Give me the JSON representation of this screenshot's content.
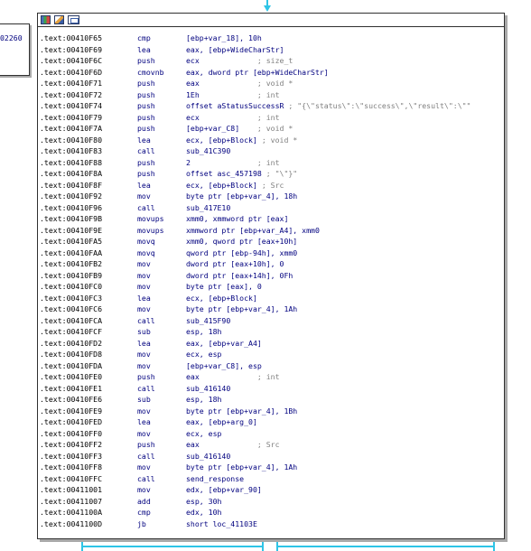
{
  "left_node": {
    "label": "02260"
  },
  "toolbar": {
    "icons": [
      "graph-overview-icon",
      "pencil-edit-icon",
      "zoom-icon"
    ]
  },
  "lines": [
    {
      "addr": ".text:00410F65",
      "mnem": "cmp",
      "ops": "[ebp+var_18], 10h",
      "cmt": ""
    },
    {
      "addr": ".text:00410F69",
      "mnem": "lea",
      "ops": "eax, [ebp+WideCharStr]",
      "cmt": ""
    },
    {
      "addr": ".text:00410F6C",
      "mnem": "push",
      "ops": "ecx             ",
      "cmt": "; size_t"
    },
    {
      "addr": ".text:00410F6D",
      "mnem": "cmovnb",
      "ops": "eax, dword ptr [ebp+WideCharStr]",
      "cmt": ""
    },
    {
      "addr": ".text:00410F71",
      "mnem": "push",
      "ops": "eax             ",
      "cmt": "; void *"
    },
    {
      "addr": ".text:00410F72",
      "mnem": "push",
      "ops": "1Eh             ",
      "cmt": "; int"
    },
    {
      "addr": ".text:00410F74",
      "mnem": "push",
      "ops": "offset aStatusSuccessR ",
      "cmt": "; \"{\\\"status\\\":\\\"success\\\",\\\"result\\\":\\\"\""
    },
    {
      "addr": ".text:00410F79",
      "mnem": "push",
      "ops": "ecx             ",
      "cmt": "; int"
    },
    {
      "addr": ".text:00410F7A",
      "mnem": "push",
      "ops": "[ebp+var_C8]    ",
      "cmt": "; void *"
    },
    {
      "addr": ".text:00410F80",
      "mnem": "lea",
      "ops": "ecx, [ebp+Block] ",
      "cmt": "; void *"
    },
    {
      "addr": ".text:00410F83",
      "mnem": "call",
      "ops": "sub_41C390",
      "cmt": ""
    },
    {
      "addr": ".text:00410F88",
      "mnem": "push",
      "ops": "2               ",
      "cmt": "; int"
    },
    {
      "addr": ".text:00410F8A",
      "mnem": "push",
      "ops": "offset asc_457198 ",
      "cmt": "; \"\\\"}\""
    },
    {
      "addr": ".text:00410F8F",
      "mnem": "lea",
      "ops": "ecx, [ebp+Block] ",
      "cmt": "; Src"
    },
    {
      "addr": ".text:00410F92",
      "mnem": "mov",
      "ops": "byte ptr [ebp+var_4], 18h",
      "cmt": ""
    },
    {
      "addr": ".text:00410F96",
      "mnem": "call",
      "ops": "sub_417E10",
      "cmt": ""
    },
    {
      "addr": ".text:00410F9B",
      "mnem": "movups",
      "ops": "xmm0, xmmword ptr [eax]",
      "cmt": ""
    },
    {
      "addr": ".text:00410F9E",
      "mnem": "movups",
      "ops": "xmmword ptr [ebp+var_A4], xmm0",
      "cmt": ""
    },
    {
      "addr": ".text:00410FA5",
      "mnem": "movq",
      "ops": "xmm0, qword ptr [eax+10h]",
      "cmt": ""
    },
    {
      "addr": ".text:00410FAA",
      "mnem": "movq",
      "ops": "qword ptr [ebp-94h], xmm0",
      "cmt": ""
    },
    {
      "addr": ".text:00410FB2",
      "mnem": "mov",
      "ops": "dword ptr [eax+10h], 0",
      "cmt": ""
    },
    {
      "addr": ".text:00410FB9",
      "mnem": "mov",
      "ops": "dword ptr [eax+14h], 0Fh",
      "cmt": ""
    },
    {
      "addr": ".text:00410FC0",
      "mnem": "mov",
      "ops": "byte ptr [eax], 0",
      "cmt": ""
    },
    {
      "addr": ".text:00410FC3",
      "mnem": "lea",
      "ops": "ecx, [ebp+Block]",
      "cmt": ""
    },
    {
      "addr": ".text:00410FC6",
      "mnem": "mov",
      "ops": "byte ptr [ebp+var_4], 1Ah",
      "cmt": ""
    },
    {
      "addr": ".text:00410FCA",
      "mnem": "call",
      "ops": "sub_415F90",
      "cmt": ""
    },
    {
      "addr": ".text:00410FCF",
      "mnem": "sub",
      "ops": "esp, 18h",
      "cmt": ""
    },
    {
      "addr": ".text:00410FD2",
      "mnem": "lea",
      "ops": "eax, [ebp+var_A4]",
      "cmt": ""
    },
    {
      "addr": ".text:00410FD8",
      "mnem": "mov",
      "ops": "ecx, esp",
      "cmt": ""
    },
    {
      "addr": ".text:00410FDA",
      "mnem": "mov",
      "ops": "[ebp+var_C8], esp",
      "cmt": ""
    },
    {
      "addr": ".text:00410FE0",
      "mnem": "push",
      "ops": "eax             ",
      "cmt": "; int"
    },
    {
      "addr": ".text:00410FE1",
      "mnem": "call",
      "ops": "sub_416140",
      "cmt": ""
    },
    {
      "addr": ".text:00410FE6",
      "mnem": "sub",
      "ops": "esp, 18h",
      "cmt": ""
    },
    {
      "addr": ".text:00410FE9",
      "mnem": "mov",
      "ops": "byte ptr [ebp+var_4], 1Bh",
      "cmt": ""
    },
    {
      "addr": ".text:00410FED",
      "mnem": "lea",
      "ops": "eax, [ebp+arg_0]",
      "cmt": ""
    },
    {
      "addr": ".text:00410FF0",
      "mnem": "mov",
      "ops": "ecx, esp",
      "cmt": ""
    },
    {
      "addr": ".text:00410FF2",
      "mnem": "push",
      "ops": "eax             ",
      "cmt": "; Src"
    },
    {
      "addr": ".text:00410FF3",
      "mnem": "call",
      "ops": "sub_416140",
      "cmt": ""
    },
    {
      "addr": ".text:00410FF8",
      "mnem": "mov",
      "ops": "byte ptr [ebp+var_4], 1Ah",
      "cmt": ""
    },
    {
      "addr": ".text:00410FFC",
      "mnem": "call",
      "ops": "send_response",
      "cmt": ""
    },
    {
      "addr": ".text:00411001",
      "mnem": "mov",
      "ops": "edx, [ebp+var_90]",
      "cmt": ""
    },
    {
      "addr": ".text:00411007",
      "mnem": "add",
      "ops": "esp, 30h",
      "cmt": ""
    },
    {
      "addr": ".text:0041100A",
      "mnem": "cmp",
      "ops": "edx, 10h",
      "cmt": ""
    },
    {
      "addr": ".text:0041100D",
      "mnem": "jb",
      "ops": "short loc_41103E",
      "cmt": ""
    }
  ],
  "colors": {
    "edge": "#2ec4e6",
    "address": "#000000",
    "instruction": "#00007f",
    "comment": "#7f7f7f",
    "border": "#303030",
    "shadow": "#a9a9a9"
  }
}
